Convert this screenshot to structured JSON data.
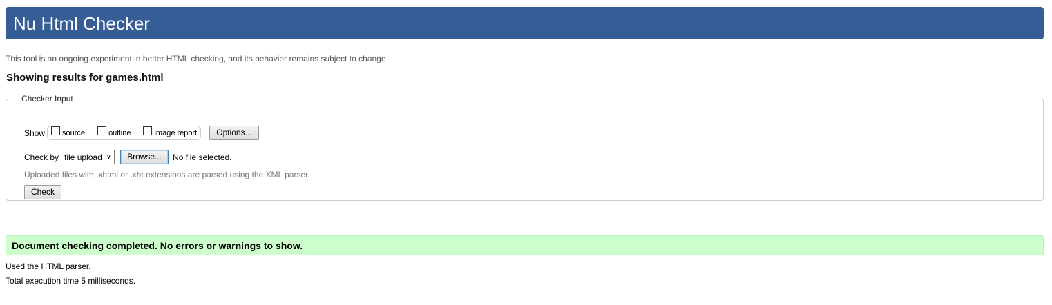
{
  "header": {
    "title": "Nu Html Checker",
    "bg_color": "#365D95"
  },
  "experiment_notice": "This tool is an ongoing experiment in better HTML checking, and its behavior remains subject to change",
  "results_heading": "Showing results for games.html",
  "checker_input": {
    "legend": "Checker Input",
    "show_label": "Show",
    "show_options": [
      {
        "label": "source",
        "checked": false
      },
      {
        "label": "outline",
        "checked": false
      },
      {
        "label": "image report",
        "checked": false
      }
    ],
    "options_button": "Options...",
    "check_by_label": "Check by",
    "check_by_selected": "file upload",
    "browse_button": "Browse...",
    "file_status": "No file selected.",
    "hint": "Uploaded files with .xhtml or .xht extensions are parsed using the XML parser.",
    "check_button": "Check"
  },
  "result": {
    "message": "Document checking completed. No errors or warnings to show.",
    "bg_color": "#ccffcc"
  },
  "info": {
    "parser": "Used the HTML parser.",
    "exec_time": "Total execution time 5 milliseconds."
  }
}
